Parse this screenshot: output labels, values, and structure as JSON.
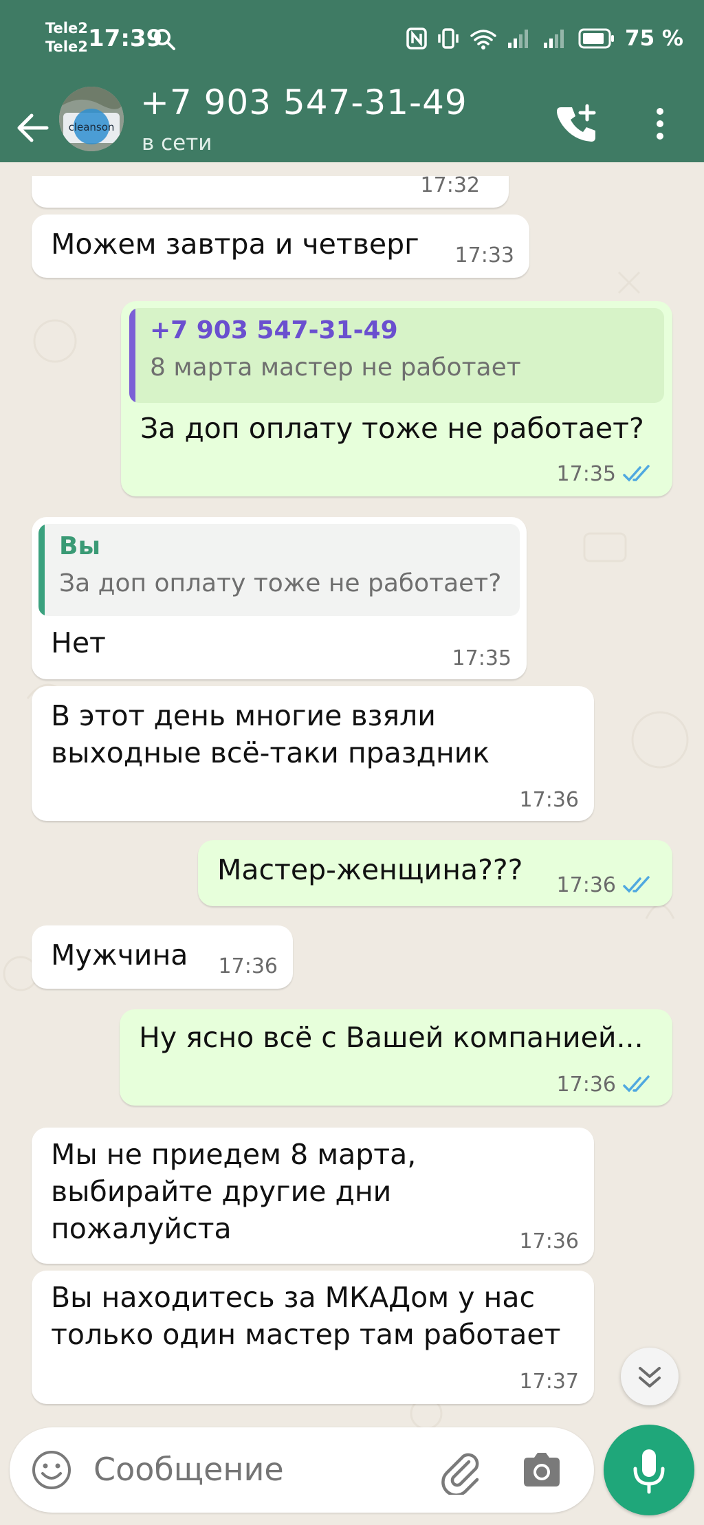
{
  "status_bar": {
    "carrier_1": "Tele2",
    "carrier_2": "Tele2",
    "time": "17:39",
    "battery": "75 %"
  },
  "header": {
    "contact": "+7 903 547-31-49",
    "presence": "в сети",
    "avatar_label": "cleanson"
  },
  "messages": [
    {
      "id": "m0",
      "dir": "in",
      "time": "17:32"
    },
    {
      "id": "m1",
      "dir": "in",
      "text": "Можем завтра и четверг",
      "time": "17:33"
    },
    {
      "id": "m2",
      "dir": "out",
      "quote_author": "+7 903 547-31-49",
      "quote_text": "8 марта мастер не работает",
      "text": "За доп оплату тоже не работает?",
      "time": "17:35"
    },
    {
      "id": "m3",
      "dir": "in",
      "quote_author": "Вы",
      "quote_text": "За доп оплату тоже не работает?",
      "text": "Нет",
      "time": "17:35"
    },
    {
      "id": "m4",
      "dir": "in",
      "lines": [
        "В этот день многие взяли",
        "выходные всё-таки праздник"
      ],
      "time": "17:36"
    },
    {
      "id": "m5",
      "dir": "out",
      "text": "Мастер-женщина???",
      "time": "17:36"
    },
    {
      "id": "m6",
      "dir": "in",
      "text": "Мужчина",
      "time": "17:36"
    },
    {
      "id": "m7",
      "dir": "out",
      "text": "Ну ясно всё с Вашей компанией...",
      "time": "17:36"
    },
    {
      "id": "m8",
      "dir": "in",
      "lines": [
        "Мы не приедем 8 марта,",
        "выбирайте другие дни",
        "пожалуйста"
      ],
      "time": "17:36"
    },
    {
      "id": "m9",
      "dir": "in",
      "lines": [
        "Вы находитесь за МКАДом у нас",
        "только один мастер там работает"
      ],
      "time": "17:37"
    }
  ],
  "composer": {
    "placeholder": "Сообщение"
  },
  "colors": {
    "header": "#3f7b64",
    "incoming": "#ffffff",
    "outgoing": "#e7ffdb",
    "read_ticks": "#4fa8e0",
    "quote_out_bar": "#7b5fd6",
    "quote_in_bar": "#3aa17e",
    "mic_button": "#1fa77a"
  },
  "icons": [
    "search-icon",
    "nfc-icon",
    "vibrate-icon",
    "wifi-icon",
    "signal-icon",
    "battery-icon",
    "back-arrow-icon",
    "add-call-icon",
    "more-vert-icon",
    "double-check-icon",
    "chevron-double-down-icon",
    "emoji-icon",
    "paperclip-icon",
    "camera-icon",
    "mic-icon"
  ]
}
